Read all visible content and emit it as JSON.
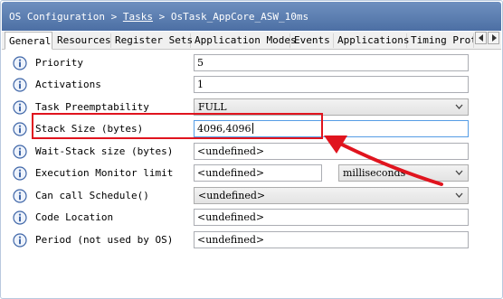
{
  "window": {
    "breadcrumb_root": "OS Configuration",
    "breadcrumb_sep": " > ",
    "breadcrumb_link": "Tasks",
    "breadcrumb_current": "OsTask_AppCore_ASW_10ms"
  },
  "tabs": [
    {
      "label": "General",
      "active": true
    },
    {
      "label": "Resources"
    },
    {
      "label": "Register Sets"
    },
    {
      "label": "Application Modes"
    },
    {
      "label": "Events"
    },
    {
      "label": "Applications"
    },
    {
      "label": "Timing Prot"
    }
  ],
  "rows": {
    "priority": {
      "label": "Priority",
      "value": "5"
    },
    "activations": {
      "label": "Activations",
      "value": "1"
    },
    "preemptability": {
      "label": "Task Preemptability",
      "value": "FULL"
    },
    "stack_size": {
      "label": "Stack Size (bytes)",
      "value": "4096,4096"
    },
    "wait_stack": {
      "label": "Wait-Stack size (bytes)",
      "value": "<undefined>"
    },
    "exec_monitor": {
      "label": "Execution Monitor limit",
      "value": "<undefined>",
      "unit": "milliseconds"
    },
    "can_call_schedule": {
      "label": "Can call Schedule()",
      "value": "<undefined>"
    },
    "code_location": {
      "label": "Code Location",
      "value": "<undefined>"
    },
    "period": {
      "label": "Period (not used by OS)",
      "value": "<undefined>"
    }
  },
  "colors": {
    "title_bar": "#5a7db3",
    "highlight": "#e0141e",
    "info_icon": "#3f66a8"
  }
}
